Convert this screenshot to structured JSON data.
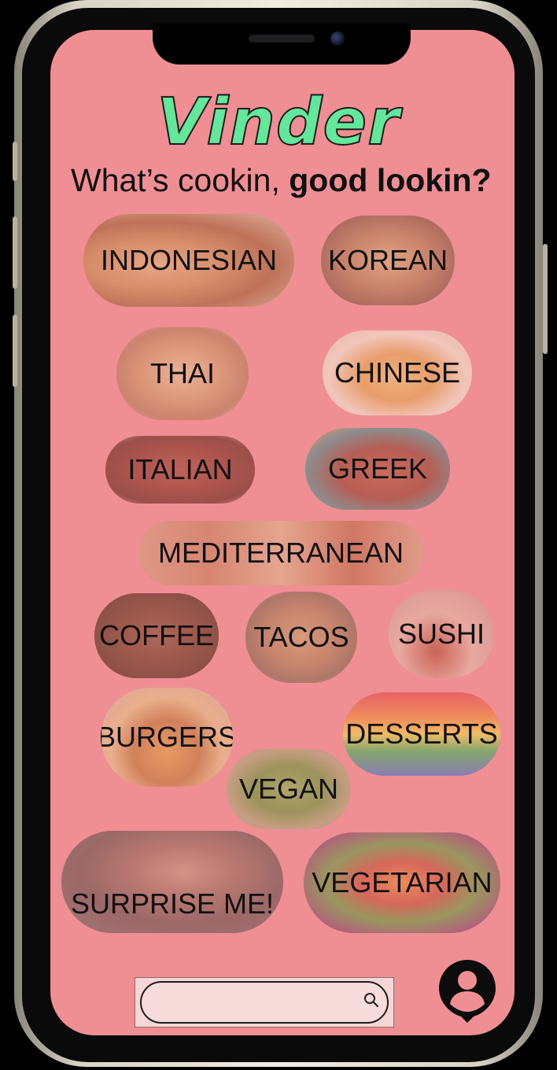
{
  "app": {
    "title": "Vinder",
    "tagline_regular": "What’s cookin, ",
    "tagline_bold": "good lookin?"
  },
  "categories": [
    {
      "id": "indonesian",
      "label": "INDONESIAN"
    },
    {
      "id": "korean",
      "label": "KOREAN"
    },
    {
      "id": "thai",
      "label": "THAI"
    },
    {
      "id": "chinese",
      "label": "CHINESE"
    },
    {
      "id": "italian",
      "label": "ITALIAN"
    },
    {
      "id": "greek",
      "label": "GREEK"
    },
    {
      "id": "mediterranean",
      "label": "MEDITERRANEAN"
    },
    {
      "id": "coffee",
      "label": "COFFEE"
    },
    {
      "id": "tacos",
      "label": "TACOS"
    },
    {
      "id": "sushi",
      "label": "SUSHI"
    },
    {
      "id": "burgers",
      "label": "BURGERS"
    },
    {
      "id": "desserts",
      "label": "DESSERTS"
    },
    {
      "id": "vegan",
      "label": "VEGAN"
    },
    {
      "id": "surprise",
      "label": "SURPRISE ME!"
    },
    {
      "id": "vegetarian",
      "label": "VEGETARIAN"
    }
  ],
  "search": {
    "placeholder": "",
    "value": ""
  },
  "icons": {
    "search": "search-icon",
    "profile": "profile-icon"
  },
  "colors": {
    "screen_background": "#ef8f93",
    "logo_fill": "#63e89b",
    "logo_outline": "#1b1b1b",
    "search_background": "#f8dcdc",
    "text": "#111111"
  }
}
